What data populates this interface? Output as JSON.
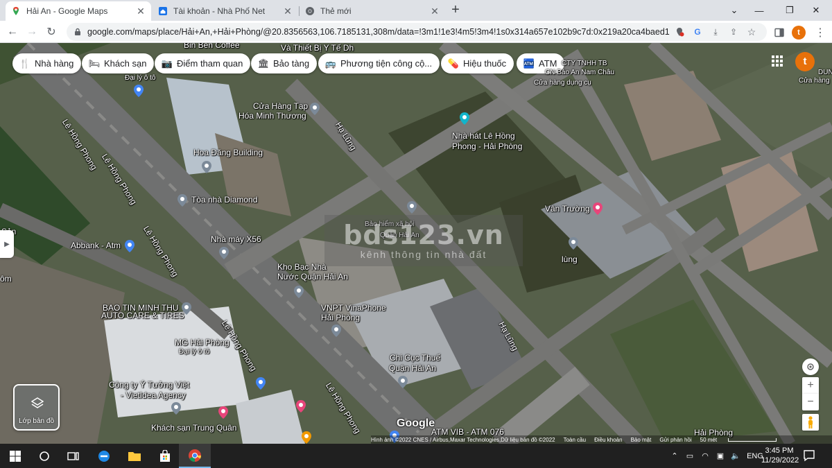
{
  "browser": {
    "tabs": [
      {
        "title": "Hải An - Google Maps",
        "active": true
      },
      {
        "title": "Tài khoản - Nhà Phố Net",
        "active": false
      },
      {
        "title": "Thẻ mới",
        "active": false
      }
    ],
    "url": "google.com/maps/place/Hải+An,+Hải+Phòng/@20.8356563,106.7185131,308m/data=!3m1!1e3!4m5!3m4!1s0x314a657e102b9c7d:0x219a20ca4baed1b...",
    "profile_initial": "t"
  },
  "map": {
    "categories": [
      "Nhà hàng",
      "Khách sạn",
      "Điểm tham quan",
      "Bảo tàng",
      "Phương tiện công cộ...",
      "Hiệu thuốc",
      "ATM"
    ],
    "avatar_initial": "t",
    "places": [
      {
        "name": "Bin Ben Coffee"
      },
      {
        "name": "Và Thiết Bị Y Tế Dh"
      },
      {
        "name": "CTY TNHH TB"
      },
      {
        "name": "CN Bảo An Nam Châu"
      },
      {
        "name": "Cửa hàng dụng cụ"
      },
      {
        "name": "DUN"
      },
      {
        "name": "Cửa hàng"
      },
      {
        "name": "Đại lý ô tô"
      },
      {
        "name": "Cửa Hàng Tạp"
      },
      {
        "name": "Hóa Minh Thương"
      },
      {
        "name": "Nhà hát Lê Hồng"
      },
      {
        "name": "Phong - Hải Phòng"
      },
      {
        "name": "Hoa Đăng Building"
      },
      {
        "name": "Tòa nhà Diamond"
      },
      {
        "name": "Vân Trường"
      },
      {
        "name": "Bảo hiểm xã hội"
      },
      {
        "name": "Quận Hải An"
      },
      {
        "name": "Abbank - Atm"
      },
      {
        "name": "Nhà máy X56"
      },
      {
        "name": "lùng"
      },
      {
        "name": "Kho Bạc Nhà"
      },
      {
        "name": "Nước Quận Hải An"
      },
      {
        "name": "BAO TIN MINH THU"
      },
      {
        "name": "AUTO CARE & TIRES"
      },
      {
        "name": "VNPT VinaPhone"
      },
      {
        "name": "Hải Phòng"
      },
      {
        "name": "MG Hải Phòng"
      },
      {
        "name": "Đại lý ô tô"
      },
      {
        "name": "Chi Cục Thuế"
      },
      {
        "name": "Quận Hải An"
      },
      {
        "name": "Công ty Ý Tưởng Việt"
      },
      {
        "name": "- VietIdea Agency"
      },
      {
        "name": "Khách sạn Trung Quân"
      },
      {
        "name": "ATM VIB - ATM 076"
      },
      {
        "name": "Hải Phòng"
      },
      {
        "name": "Sản"
      },
      {
        "name": "ôm"
      }
    ],
    "roads": [
      "Lê Hồng Phong",
      "Lê Hồng Phong",
      "Lê Hồng Phong",
      "Lê Hồng Phong",
      "Lê Hồng Phong",
      "Hạ Lũng",
      "Hạ Lũng"
    ],
    "layers_label": "Lớp bản đồ",
    "google_logo": "Google",
    "attribution": {
      "imagery": "Hình ảnh ©2022 CNES / Airbus,Maxar Technologies,Dữ liệu bản đồ ©2022",
      "links": [
        "Toàn cầu",
        "Điều khoản",
        "Bảo mật",
        "Gửi phản hồi"
      ],
      "scale": "50 mét"
    },
    "watermark": {
      "title": "bds123.vn",
      "subtitle": "kênh thông tin nhà đất"
    }
  },
  "taskbar": {
    "language": "ENG",
    "time": "3:45 PM",
    "date": "11/29/2022"
  }
}
